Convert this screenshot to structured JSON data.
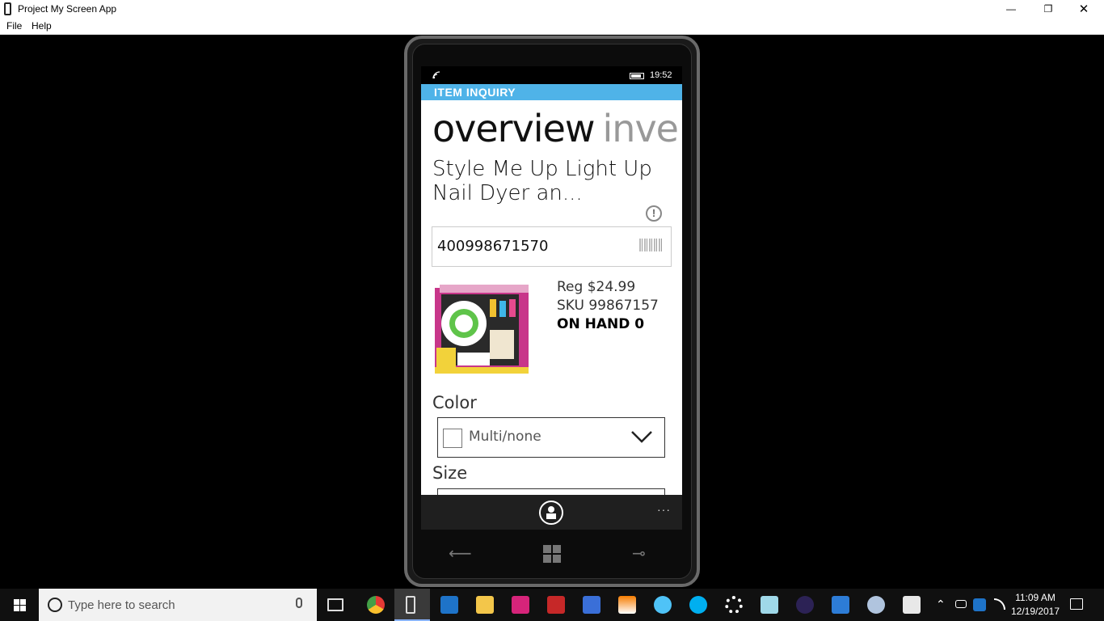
{
  "window": {
    "title": "Project My Screen App",
    "menu": [
      "File",
      "Help"
    ],
    "controls": {
      "minimize": "—",
      "restore": "❐",
      "close": "✕"
    }
  },
  "phone": {
    "status": {
      "time": "19:52"
    },
    "header": "ITEM INQUIRY",
    "pivot": {
      "active": "overview",
      "next": "inve"
    },
    "item_name": "Style Me Up Light Up Nail Dyer an...",
    "sku_input_value": "400998671570",
    "price": "Reg $24.99",
    "sku": "SKU 99867157",
    "on_hand": "ON HAND 0",
    "color_label": "Color",
    "color_value": "Multi/none",
    "size_label": "Size",
    "more": "···",
    "info_glyph": "!",
    "hw": {
      "back": "⟵",
      "search": "⊸"
    }
  },
  "taskbar": {
    "search_placeholder": "Type here to search",
    "time": "11:09 AM",
    "date": "12/19/2017",
    "apps": [
      "chrome",
      "phone-projector",
      "outlook",
      "file-explorer",
      "intellij",
      "rsa",
      "remote-desktop",
      "vlc",
      "pinwheel",
      "skype",
      "settings",
      "notepad",
      "eclipse",
      "visual-studio-code",
      "paint",
      "java"
    ]
  }
}
